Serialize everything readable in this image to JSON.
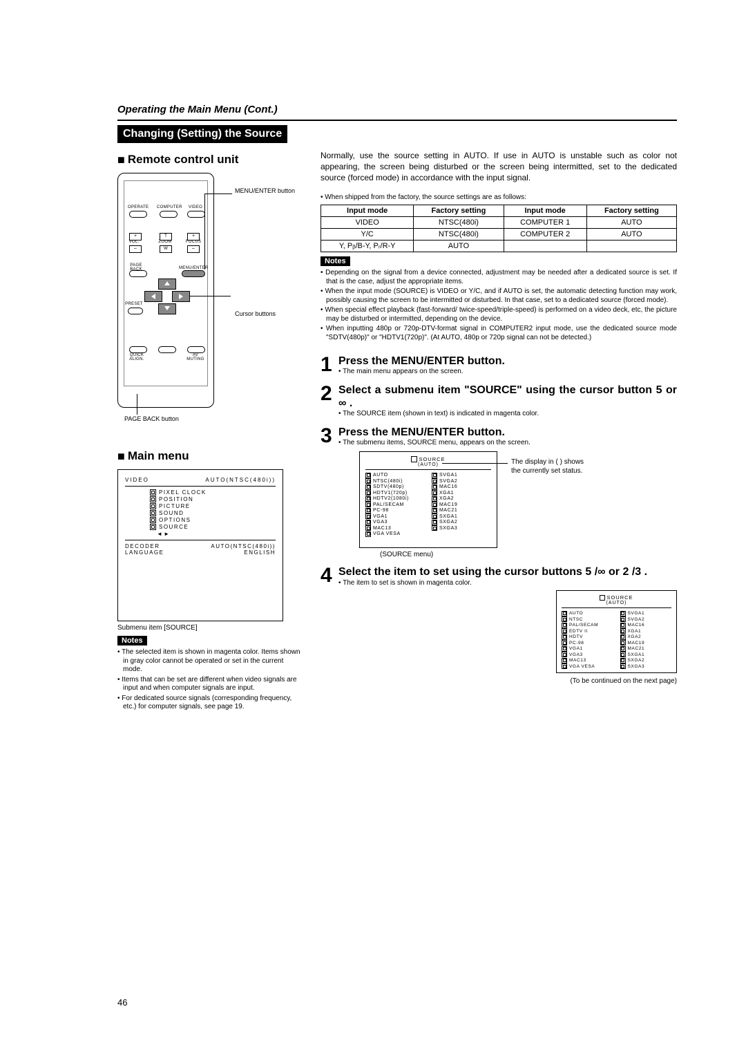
{
  "header": {
    "section": "Operating the Main Menu (Cont.)",
    "blackbar": "Changing (Setting) the Source"
  },
  "left": {
    "subsection1": "Remote control unit",
    "remote_labels": {
      "menu_enter": "MENU/ENTER button",
      "cursor": "Cursor buttons",
      "pageback": "PAGE BACK button",
      "operate": "OPERATE",
      "computer": "COMPUTER",
      "video": "VIDEO",
      "vol": "VOL.",
      "zoom": "ZOOM",
      "focus": "FOCUS",
      "t": "T",
      "w": "W",
      "plus": "+",
      "minus": "–",
      "page_back_btn": "PAGE BACK",
      "menu_enter_btn": "MENU/ENTER",
      "preset": "PRESET",
      "quick_align": "QUICK ALIGN.",
      "av_muting": "AV MUTING"
    },
    "subsection2": "Main menu",
    "main_menu": {
      "top_left": "VIDEO",
      "top_right": "AUTO(NTSC(480i))",
      "items": [
        "PIXEL CLOCK",
        "POSITION",
        "PICTURE",
        "SOUND",
        "OPTIONS",
        "SOURCE"
      ],
      "decoder_label": "DECODER",
      "decoder_value": "AUTO(NTSC(480i))",
      "language_label": "LANGUAGE",
      "language_value": "ENGLISH"
    },
    "submenu_caption": "Submenu item [SOURCE]",
    "notes_label": "Notes",
    "notes": [
      "• The selected item is shown in magenta color. Items shown in gray color cannot be operated or set in the current mode.",
      "• Items that can be set are different when video signals are input and when computer signals are input.",
      "• For dedicated source signals (corresponding frequency, etc.) for computer signals, see page 19."
    ]
  },
  "right": {
    "intro": "Normally, use the source setting in AUTO. If use in AUTO is unstable such as color not appearing, the screen being disturbed or the screen being intermitted, set to the dedicated source (forced mode) in accordance with the input signal.",
    "ship_note": "• When shipped from the factory, the source settings are as follows:",
    "factory_table": {
      "headers": [
        "Input mode",
        "Factory setting",
        "Input mode",
        "Factory setting"
      ],
      "rows": [
        [
          "VIDEO",
          "NTSC(480i)",
          "COMPUTER 1",
          "AUTO"
        ],
        [
          "Y/C",
          "NTSC(480i)",
          "COMPUTER 2",
          "AUTO"
        ],
        [
          "Y, Pᵦ/B-Y, Pᵣ/R-Y",
          "AUTO",
          "",
          ""
        ]
      ]
    },
    "notes_label": "Notes",
    "notes": [
      "• Depending on the signal from a device connected, adjustment may be needed after a dedicated source is set. If that is the case, adjust the appropriate items.",
      "• When the input mode (SOURCE) is VIDEO or Y/C, and if AUTO is set, the automatic detecting function may work, possibly causing the screen to be intermitted or disturbed. In that case, set to a dedicated source (forced mode).",
      "• When special effect playback (fast-forward/ twice-speed/triple-speed) is performed on a video deck, etc, the picture may be disturbed or intermitted, depending on the device.",
      "• When inputting 480p or 720p-DTV-format signal in COMPUTER2 input mode, use the dedicated source mode \"SDTV(480p)\" or \"HDTV1(720p)\". (At AUTO, 480p or 720p signal can not be detected.)"
    ],
    "steps": {
      "s1_title": "Press the MENU/ENTER button.",
      "s1_sub": "• The main menu appears on the screen.",
      "s2_title": "Select a submenu item \"SOURCE\" using the cursor button 5  or ∞ .",
      "s2_sub": "• The SOURCE item (shown in text) is indicated in magenta color.",
      "s3_title": "Press the MENU/ENTER button.",
      "s3_sub": "• The submenu items, SOURCE menu, appears on the screen.",
      "s4_title": "Select the item to set using the cursor buttons 5 /∞  or 2 /3 .",
      "s4_sub": "• The item to set is shown in magenta color."
    },
    "source_menu1": {
      "title": "SOURCE",
      "sub": "(AUTO)",
      "left": [
        "AUTO",
        "NTSC(480i)",
        "SDTV(480p)",
        "HDTV1(720p)",
        "HDTV2(1080i)",
        "PAL/SECAM",
        "PC-98",
        "VGA1",
        "VGA3",
        "MAC13",
        "VGA VESA"
      ],
      "right": [
        "SVGA1",
        "SVGA2",
        "MAC16",
        "XGA1",
        "XGA2",
        "MAC19",
        "MAC21",
        "SXGA1",
        "SXGA2",
        "SXGA3"
      ],
      "caption": "(SOURCE menu)",
      "lead_text": "The display in (  ) shows the currently set status."
    },
    "source_menu2": {
      "title": "SOURCE",
      "sub": "(AUTO)",
      "left": [
        "AUTO",
        "NTSC",
        "PAL/SECAM",
        "EDTV II",
        "HDTV",
        "PC-98",
        "VGA1",
        "VGA3",
        "MAC13",
        "VGA VESA"
      ],
      "right": [
        "SVGA1",
        "SVGA2",
        "MAC16",
        "XGA1",
        "XGA2",
        "MAC19",
        "MAC21",
        "SXGA1",
        "SXGA2",
        "SXGA3"
      ]
    },
    "to_be_continued": "(To be continued on the next page)"
  },
  "page_number": "46"
}
